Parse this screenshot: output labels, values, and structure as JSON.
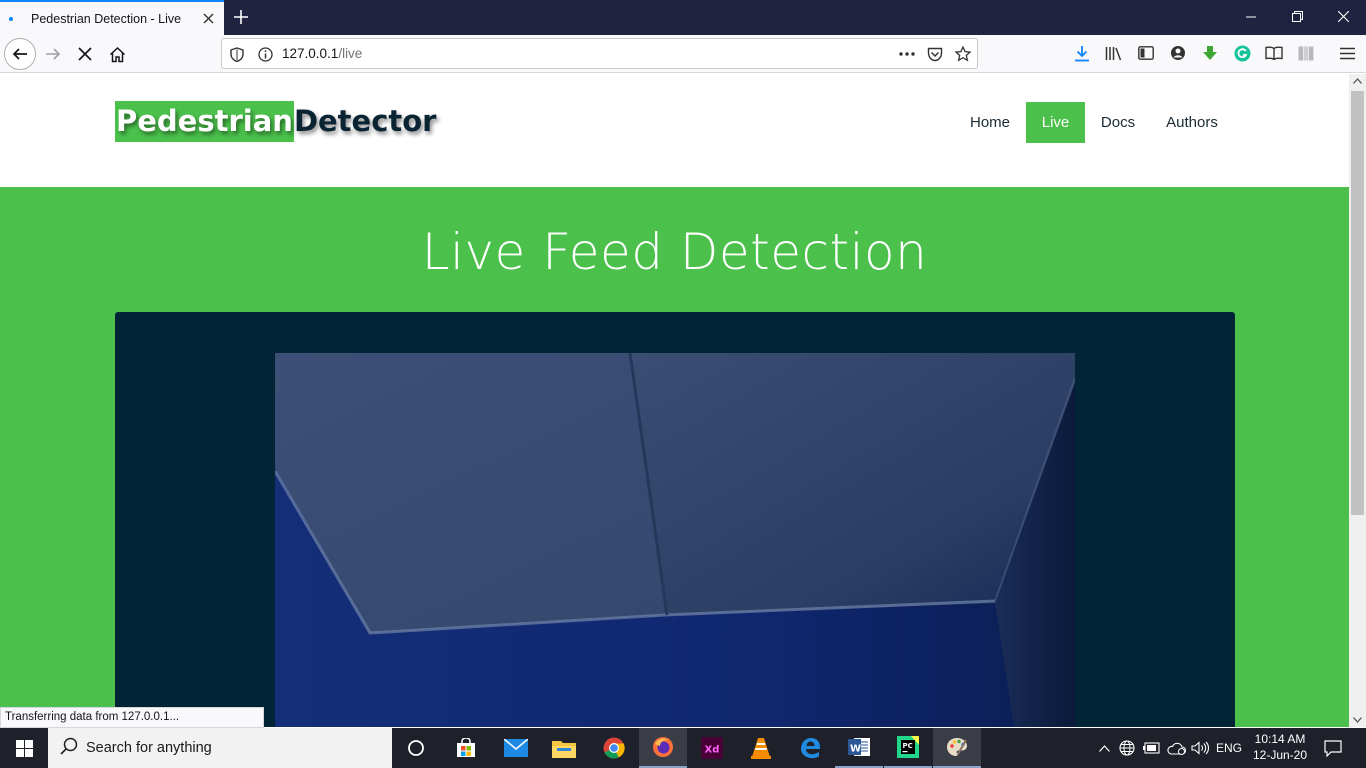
{
  "browser": {
    "tab_title": "Pedestrian Detection - Live",
    "url_host": "127.0.0.1",
    "url_path": "/live",
    "status_text": "Transferring data from 127.0.0.1..."
  },
  "site": {
    "logo_part1": "Pedestrian",
    "logo_part2": "Detector",
    "nav": [
      "Home",
      "Live",
      "Docs",
      "Authors"
    ],
    "active_nav": "Live",
    "hero_title": "Live Feed Detection"
  },
  "taskbar": {
    "search_placeholder": "Search for anything",
    "lang": "ENG",
    "time": "10:14 AM",
    "date": "12-Jun-20",
    "apps": [
      "task-view",
      "microsoft-store",
      "mail",
      "file-explorer",
      "chrome",
      "firefox",
      "adobe-xd",
      "vlc",
      "edge",
      "word",
      "pycharm",
      "paint"
    ]
  },
  "colors": {
    "accent_green": "#4bc14b",
    "dark_navy": "#022437",
    "tab_indicator": "#0a84ff"
  }
}
